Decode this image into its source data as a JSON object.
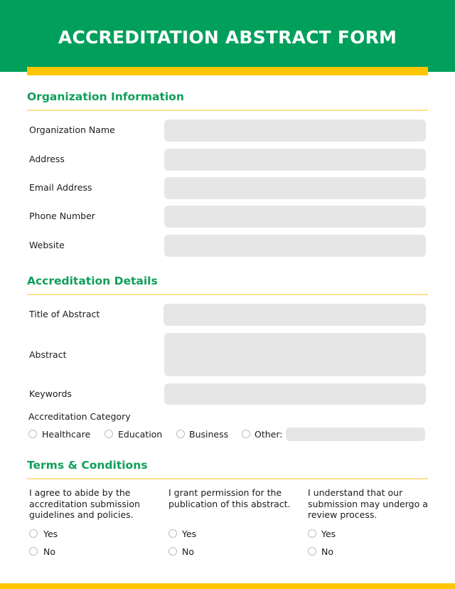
{
  "header": {
    "title": "ACCREDITATION ABSTRACT FORM"
  },
  "colors": {
    "brand_green": "#009F5B",
    "accent_yellow": "#FFC600",
    "heading_green": "#0F9F5A",
    "field_gray": "#E6E6E6",
    "divider_yellow": "#FCE08E"
  },
  "organization": {
    "heading": "Organization Information",
    "fields": [
      {
        "label": "Organization Name",
        "value": ""
      },
      {
        "label": "Address",
        "value": ""
      },
      {
        "label": "Email Address",
        "value": ""
      },
      {
        "label": "Phone Number",
        "value": ""
      },
      {
        "label": "Website",
        "value": ""
      }
    ]
  },
  "accreditation": {
    "heading": "Accreditation Details",
    "fields": [
      {
        "label": "Title of Abstract",
        "value": ""
      },
      {
        "label": "Abstract",
        "value": ""
      },
      {
        "label": "Keywords",
        "value": ""
      }
    ],
    "category": {
      "label": "Accreditation Category",
      "options": [
        "Healthcare",
        "Education",
        "Business",
        "Other:"
      ],
      "selected": null,
      "other_value": ""
    }
  },
  "terms": {
    "heading": "Terms & Conditions",
    "items": [
      {
        "text": "I agree to abide by the accreditation submission guidelines and policies.",
        "yes": "Yes",
        "no": "No",
        "selected": null
      },
      {
        "text": "I grant permission for the publication of this abstract.",
        "yes": "Yes",
        "no": "No",
        "selected": null
      },
      {
        "text": "I understand that our submission may undergo a review process.",
        "yes": "Yes",
        "no": "No",
        "selected": null
      }
    ]
  }
}
